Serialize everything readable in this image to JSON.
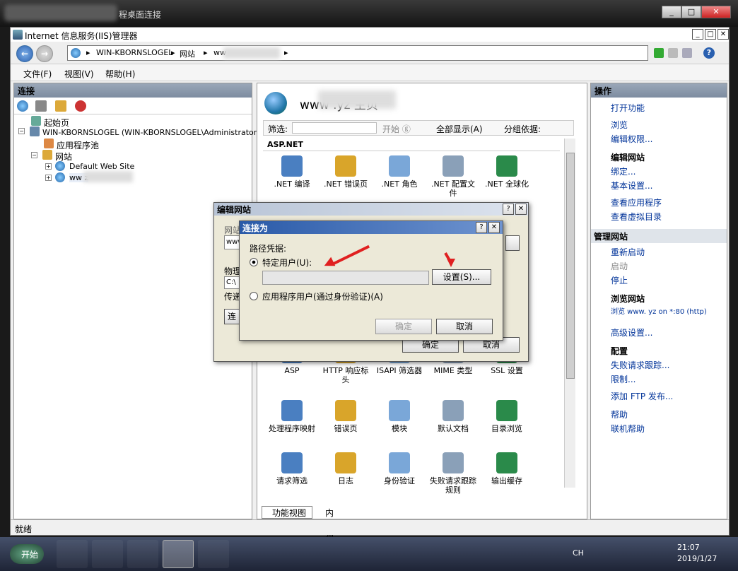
{
  "rdp": {
    "title": "程桌面连接"
  },
  "window": {
    "title": "Internet 信息服务(IIS)管理器",
    "min": "_",
    "max": "□",
    "close": "✕"
  },
  "address": {
    "server": "WIN-KBORNSLOGEL",
    "sep1": "▸",
    "sites": "网站",
    "sep2": "▸",
    "site": "ww",
    "sep3": "▸"
  },
  "menu": {
    "file": "文件(F)",
    "view": "视图(V)",
    "help": "帮助(H)"
  },
  "connections": {
    "title": "连接",
    "start": "起始页",
    "server": "WIN-KBORNSLOGEL (WIN-KBORNSLOGEL\\Administrator)",
    "apppools": "应用程序池",
    "sites": "网站",
    "default": "Default Web Site",
    "site": "ww                    z"
  },
  "center": {
    "title": "www                  .yz 主页",
    "filter_label": "筛选:",
    "start": "开始 ⓖ",
    "showall": "全部显示(A)",
    "groupby": "分组依据:",
    "section": "ASP.NET",
    "row1": [
      ".NET 编译",
      ".NET 错误页",
      ".NET 角色",
      ".NET 配置文件",
      ".NET 全球化"
    ],
    "row2": [
      "ASP",
      "HTTP 响应标头",
      "ISAPI 筛选器",
      "MIME 类型",
      "SSL 设置"
    ],
    "row3": [
      "处理程序映射",
      "错误页",
      "模块",
      "默认文档",
      "目录浏览"
    ],
    "row4": [
      "请求筛选",
      "日志",
      "身份验证",
      "失败请求跟踪规则",
      "输出缓存"
    ],
    "tab_features": "功能视图",
    "tab_content": "内容视图"
  },
  "actions": {
    "title": "操作",
    "open": "打开功能",
    "browse": "浏览",
    "editperm": "编辑权限...",
    "editsite": "编辑网站",
    "bind": "绑定...",
    "basic": "基本设置...",
    "viewapps": "查看应用程序",
    "viewvdirs": "查看虚拟目录",
    "manage": "管理网站",
    "restart": "重新启动",
    "start": "启动",
    "stop": "停止",
    "browsesite": "浏览网站",
    "browse_url": "浏览 www.              yz on *:80 (http)",
    "advanced": "高级设置...",
    "config": "配置",
    "failtrace": "失败请求跟踪...",
    "limits": "限制...",
    "addftp": "添加 FTP 发布...",
    "help": "帮助",
    "onlinehelp": "联机帮助"
  },
  "edit_dialog": {
    "title": "编辑网站",
    "q": "?",
    "x": "✕",
    "sitename": "网站",
    "sitename_val": "www",
    "physical": "物理",
    "path": "C:\\",
    "passthrough": "传递",
    "connect": "连",
    "ok": "确定",
    "cancel": "取消"
  },
  "connect_dialog": {
    "title": "连接为",
    "q": "?",
    "x": "✕",
    "cred_label": "路径凭据:",
    "specific": "特定用户(U):",
    "settings": "设置(S)...",
    "appuser": "应用程序用户(通过身份验证)(A)",
    "ok": "确定",
    "cancel": "取消"
  },
  "status": {
    "text": "就绪"
  },
  "taskbar": {
    "start": "开始",
    "lang": "CH",
    "time": "21:07",
    "date": "2019/1/27"
  }
}
